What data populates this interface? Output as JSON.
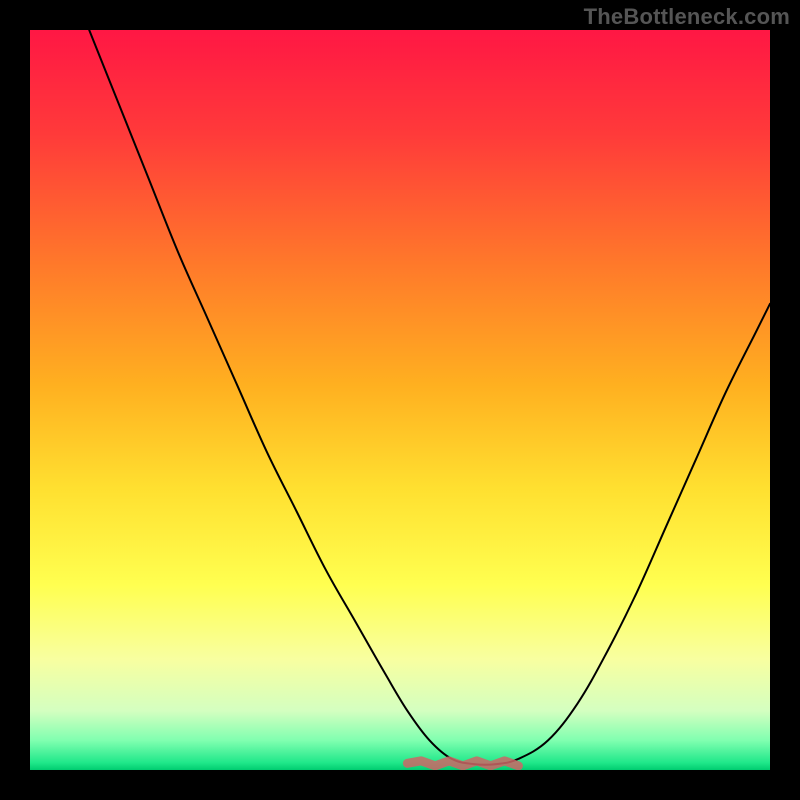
{
  "watermark": "TheBottleneck.com",
  "chart_data": {
    "type": "line",
    "title": "",
    "xlabel": "",
    "ylabel": "",
    "xlim": [
      0,
      100
    ],
    "ylim": [
      0,
      100
    ],
    "gradient_stops": [
      {
        "offset": 0,
        "color": "#ff1744"
      },
      {
        "offset": 14,
        "color": "#ff3a3a"
      },
      {
        "offset": 32,
        "color": "#ff7a2a"
      },
      {
        "offset": 48,
        "color": "#ffb020"
      },
      {
        "offset": 62,
        "color": "#ffe030"
      },
      {
        "offset": 75,
        "color": "#ffff50"
      },
      {
        "offset": 85,
        "color": "#f8ffa0"
      },
      {
        "offset": 92,
        "color": "#d4ffc0"
      },
      {
        "offset": 96,
        "color": "#80ffb0"
      },
      {
        "offset": 99,
        "color": "#20e88a"
      },
      {
        "offset": 100,
        "color": "#00cc70"
      }
    ],
    "series": [
      {
        "name": "bottleneck-curve",
        "x": [
          8,
          12,
          16,
          20,
          24,
          28,
          32,
          36,
          40,
          44,
          48,
          51,
          54,
          57,
          60,
          63,
          66,
          70,
          74,
          78,
          82,
          86,
          90,
          94,
          98,
          100
        ],
        "y": [
          100,
          90,
          80,
          70,
          61,
          52,
          43,
          35,
          27,
          20,
          13,
          8,
          4,
          1.5,
          0.8,
          0.8,
          1.5,
          4,
          9,
          16,
          24,
          33,
          42,
          51,
          59,
          63
        ]
      }
    ],
    "optimal_band": {
      "x_start": 51,
      "x_end": 66,
      "y": 0.9
    }
  }
}
